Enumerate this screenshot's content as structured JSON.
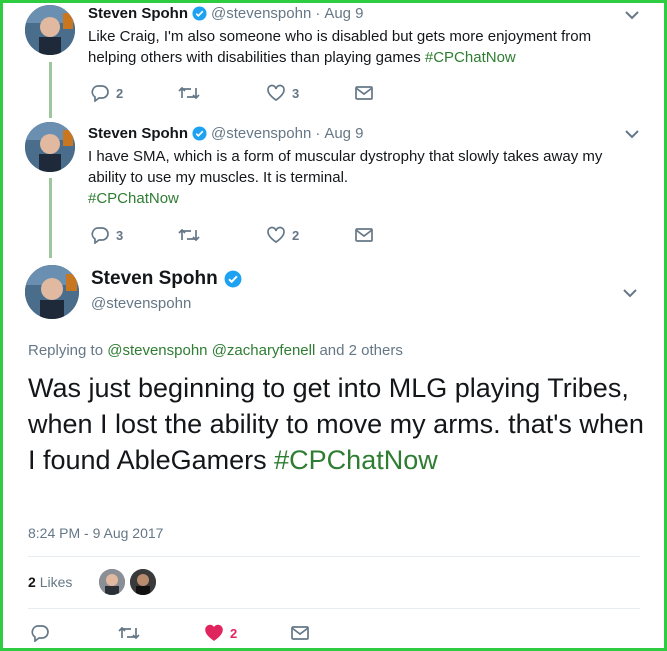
{
  "tweets": [
    {
      "author": "Steven Spohn",
      "handle": "@stevenspohn",
      "date": "Aug 9",
      "text": "Like Craig, I'm also someone who is disabled but gets more enjoyment from helping others with disabilities than playing games",
      "hashtag": "#CPChatNow",
      "replies": "2",
      "retweets": "",
      "likes": "3"
    },
    {
      "author": "Steven Spohn",
      "handle": "@stevenspohn",
      "date": "Aug 9",
      "text_line1": "I have SMA, which is a form of muscular dystrophy that slowly takes away my",
      "text_line2": "ability to use my muscles. It is terminal.",
      "hashtag": "#CPChatNow",
      "replies": "3",
      "retweets": "",
      "likes": "2"
    }
  ],
  "main": {
    "author": "Steven Spohn",
    "handle": "@stevenspohn",
    "replying_prefix": "Replying to",
    "replying_users": [
      "@stevenspohn",
      "@zacharyfenell"
    ],
    "replying_suffix": "and 2 others",
    "text": "Was just beginning to get into MLG playing Tribes, when I lost the ability to move my arms. that's when I found AbleGamers",
    "hashtag": "#CPChatNow",
    "timestamp": "8:24 PM - 9 Aug 2017",
    "likes_count": "2",
    "likes_label": "Likes",
    "action_likes": "2"
  },
  "colors": {
    "accent_hashtag": "#2e7d32",
    "border": "#2ecc40",
    "heart": "#e0245e"
  }
}
